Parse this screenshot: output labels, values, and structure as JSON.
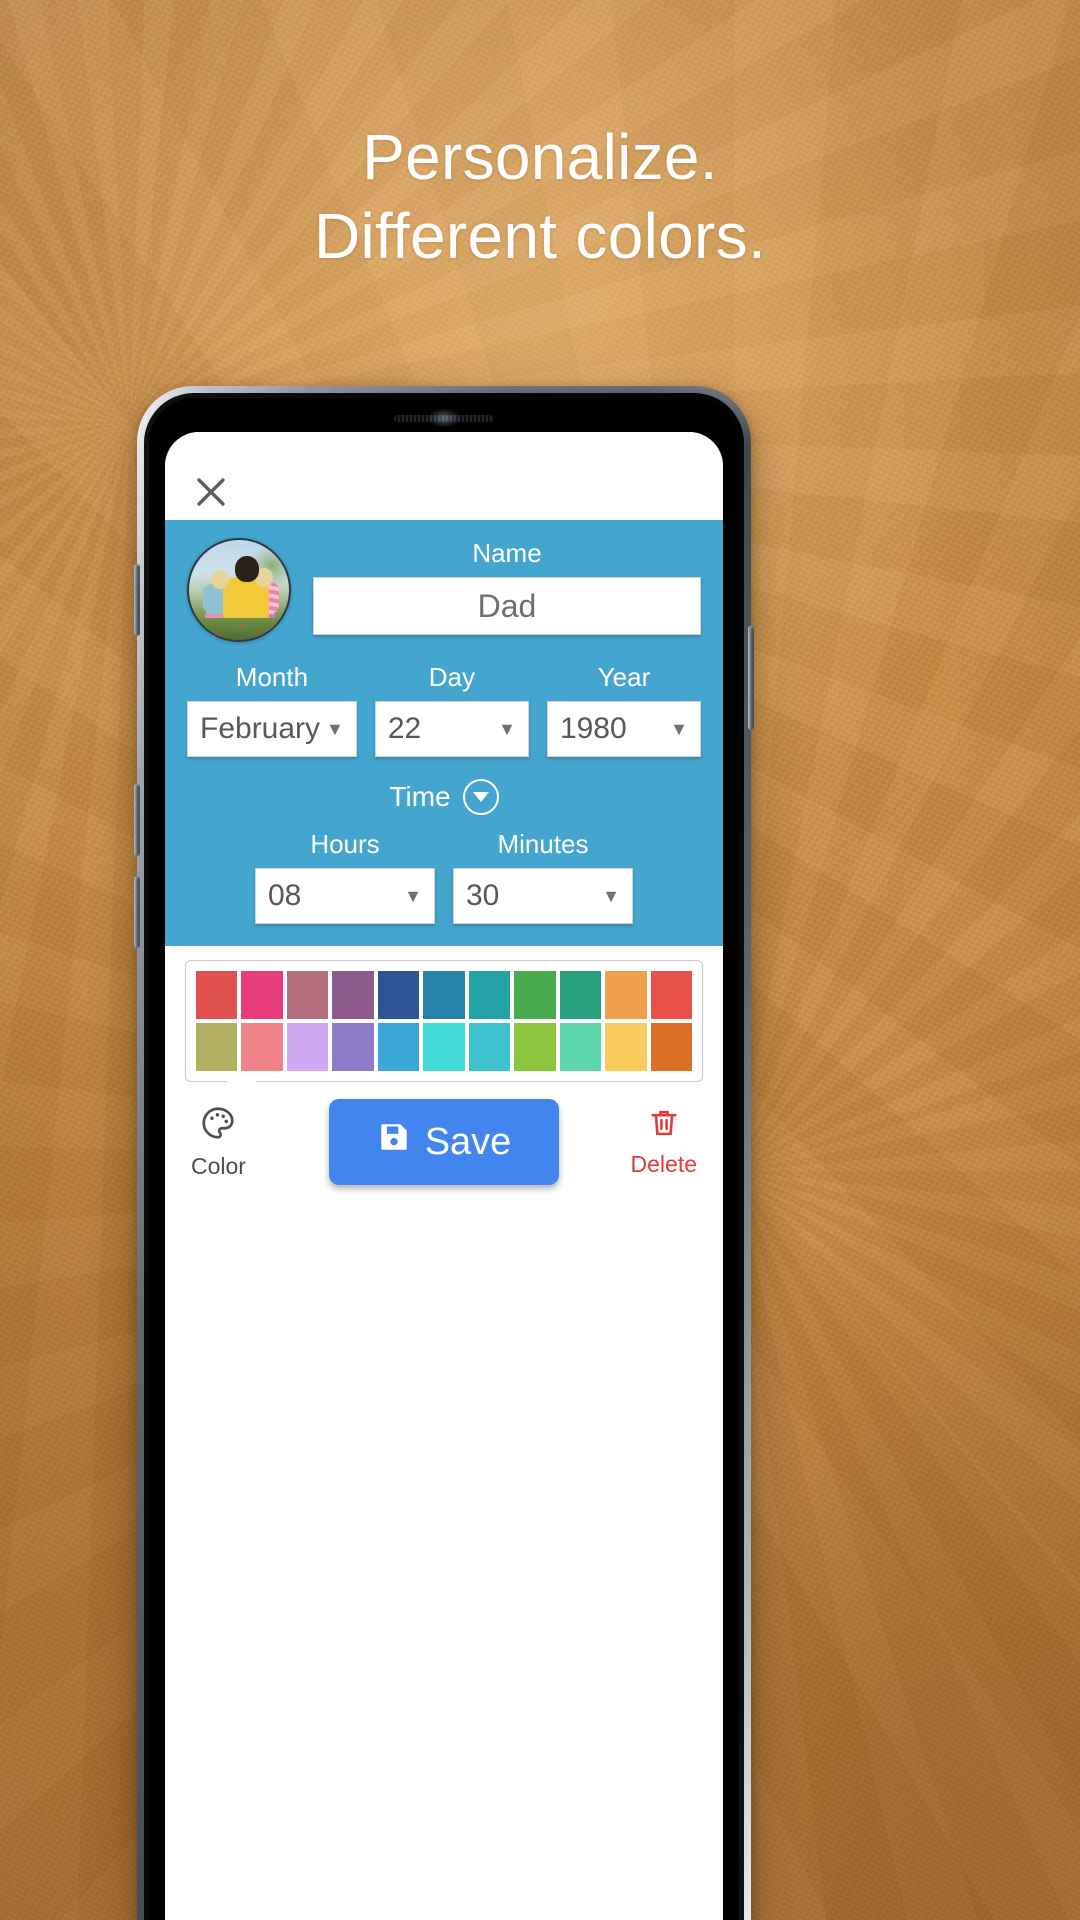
{
  "promo": {
    "headline_line1": "Personalize.",
    "headline_line2": "Different colors.",
    "background_color": "#cf9044",
    "headline_color": "#ffffff"
  },
  "app": {
    "accent_color": "#44a6cf",
    "close_icon": "close-icon",
    "form": {
      "avatar": "contact-photo",
      "name": {
        "label": "Name",
        "value": "Dad"
      },
      "month": {
        "label": "Month",
        "value": "February",
        "caret": "▼"
      },
      "day": {
        "label": "Day",
        "value": "22",
        "caret": "▼"
      },
      "year": {
        "label": "Year",
        "value": "1980",
        "caret": "▼"
      },
      "time": {
        "label": "Time",
        "toggle_icon": "chevron-down-circle-icon"
      },
      "hours": {
        "label": "Hours",
        "value": "08",
        "caret": "▼"
      },
      "minutes": {
        "label": "Minutes",
        "value": "30",
        "caret": "▼"
      }
    },
    "palette": {
      "row1": [
        "#e0504f",
        "#e83c7c",
        "#b4707f",
        "#8d5a8e",
        "#2f5496",
        "#2682a8",
        "#23a3a6",
        "#4aab4e",
        "#2aa17e",
        "#efa04a",
        "#e9504a"
      ],
      "row2": [
        "#b2b161",
        "#ef8287",
        "#cfaaf2",
        "#8e7cc8",
        "#3ba7d6",
        "#43dcd9",
        "#3ec2cd",
        "#8cc63e",
        "#5ed7ae",
        "#f7cb5c",
        "#db6f25"
      ]
    },
    "toolbar": {
      "color": {
        "label": "Color",
        "icon": "palette-icon"
      },
      "save": {
        "label": "Save",
        "icon": "save-floppy-icon",
        "color": "#4285ef"
      },
      "delete": {
        "label": "Delete",
        "icon": "trash-icon",
        "color": "#e03b3b"
      }
    }
  }
}
